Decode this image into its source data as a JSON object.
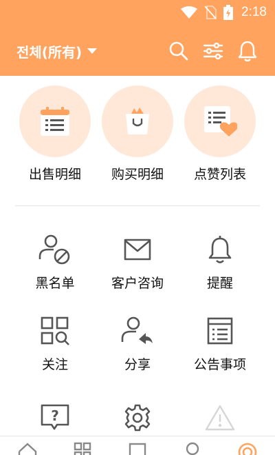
{
  "status_bar": {
    "time": "2:18",
    "icons": [
      "wifi-icon",
      "no-sim-icon",
      "battery-charging-icon"
    ]
  },
  "header": {
    "scope_label": "전체(所有)",
    "icons": [
      "search-icon",
      "filter-sliders-icon",
      "bell-icon"
    ]
  },
  "featured": [
    {
      "label": "出售明细",
      "icon": "calendar-list-icon"
    },
    {
      "label": "购买明细",
      "icon": "shopping-bag-icon"
    },
    {
      "label": "点赞列表",
      "icon": "list-heart-icon"
    }
  ],
  "menu": [
    {
      "label": "黑名单",
      "icon": "user-blocked-icon"
    },
    {
      "label": "客户咨询",
      "icon": "mail-icon"
    },
    {
      "label": "提醒",
      "icon": "bell-icon"
    },
    {
      "label": "关注",
      "icon": "grid-search-icon"
    },
    {
      "label": "分享",
      "icon": "user-share-icon"
    },
    {
      "label": "公告事项",
      "icon": "notice-board-icon"
    },
    {
      "label": "",
      "icon": "help-message-icon"
    },
    {
      "label": "",
      "icon": "gear-icon"
    },
    {
      "label": "",
      "icon": "warning-icon"
    }
  ],
  "bottom_nav": [
    "home-icon",
    "categories-icon",
    "square-icon",
    "profile-icon",
    "my-page-icon"
  ],
  "colors": {
    "accent": "#FFA35E",
    "icon_bg": "#FFE8D8",
    "icon_gray": "#555555"
  }
}
